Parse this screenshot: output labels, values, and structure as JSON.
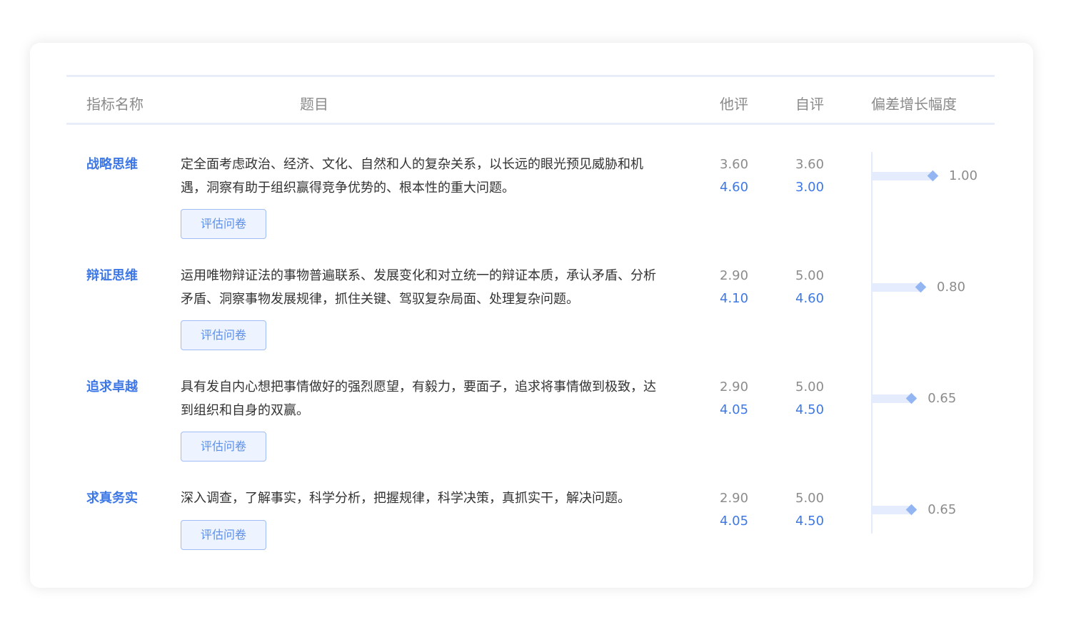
{
  "headers": {
    "name": "指标名称",
    "question": "题目",
    "other": "他评",
    "self": "自评",
    "growth": "偏差增长幅度"
  },
  "button_label": "评估问卷",
  "colors": {
    "accent": "#3d78e6",
    "muted": "#8c8c8c",
    "button_bg": "#eef4ff",
    "bar": "#e4ecfd",
    "diamond": "#93b6f3"
  },
  "rows": [
    {
      "name": "战略思维",
      "question": "定全面考虑政治、经济、文化、自然和人的复杂关系，以长远的眼光预见威胁和机遇，洞察有助于组织赢得竞争优势的、根本性的重大问题。",
      "other_before": "3.60",
      "other_after": "4.60",
      "self_before": "3.60",
      "self_after": "3.00",
      "growth": "1.00",
      "growth_value": 1.0
    },
    {
      "name": "辩证思维",
      "question": "运用唯物辩证法的事物普遍联系、发展变化和对立统一的辩证本质，承认矛盾、分析矛盾、洞察事物发展规律，抓住关键、驾驭复杂局面、处理复杂问题。",
      "other_before": "2.90",
      "other_after": "4.10",
      "self_before": "5.00",
      "self_after": "4.60",
      "growth": "0.80",
      "growth_value": 0.8
    },
    {
      "name": "追求卓越",
      "question": "具有发自内心想把事情做好的强烈愿望，有毅力，要面子，追求将事情做到极致，达到组织和自身的双赢。",
      "other_before": "2.90",
      "other_after": "4.05",
      "self_before": "5.00",
      "self_after": "4.50",
      "growth": "0.65",
      "growth_value": 0.65
    },
    {
      "name": "求真务实",
      "question": "深入调查，了解事实，科学分析，把握规律，科学决策，真抓实干，解决问题。",
      "other_before": "2.90",
      "other_after": "4.05",
      "self_before": "5.00",
      "self_after": "4.50",
      "growth": "0.65",
      "growth_value": 0.65
    }
  ]
}
